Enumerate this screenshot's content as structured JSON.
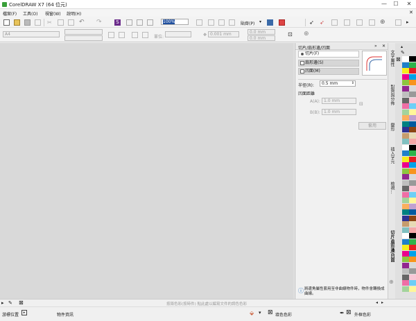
{
  "window": {
    "title": "CorelDRAW X7 (64 位元)",
    "minimize": "—",
    "maximize": "☐",
    "close": "✕"
  },
  "menu": [
    "檔案(F)",
    "工具(O)",
    "視窗(W)",
    "說明(H)"
  ],
  "toolbar": {
    "zoom": "100%",
    "snap_label": "貼齊(P)"
  },
  "propbar": {
    "page_size": "A4",
    "units_label": "單位:",
    "nudge": "0.001 mm",
    "dup_x": "0.0 mm",
    "dup_y": "0.0 mm"
  },
  "docker": {
    "title": "切片/扇形邊/凹面",
    "options": [
      {
        "label": "切片(F)",
        "checked": true
      },
      {
        "label": "扇形邊(S)",
        "checked": false
      },
      {
        "label": "凹面(M)",
        "checked": false
      }
    ],
    "radius_label": "半徑(R):",
    "radius_value": "0.5 mm",
    "group_label": "凹面距離",
    "a_label": "A(A):",
    "a_value": "1.0 mm",
    "b_label": "B(B):",
    "b_value": "1.0 mm",
    "apply": "套用",
    "hint": "將邊角屬性套用至非曲線物件時，物件會轉換成曲線。"
  },
  "tabs": [
    "文字屬性",
    "對齊與分佈",
    "變形",
    "插入字元",
    "檢視...",
    "切片/扇形邊/凹面"
  ],
  "status": {
    "hint_text": "按兩色彩(按時件) 點此處以編寫文件的調色色彩",
    "cursor_label": "游標位置",
    "object_info": "物件資訊",
    "fill_label": "填色色彩",
    "outline_label": "外框色彩"
  },
  "palette_colors": [
    "#ffffff",
    "#000000",
    "#1f7fc9",
    "#2db34a",
    "#f6ec1c",
    "#e51c24",
    "#ec008c",
    "#00a2e9",
    "#8dc63f",
    "#f7941d",
    "#92278f",
    "#d9d9d9",
    "#bfbfbf",
    "#999999",
    "#666666",
    "#f9c7d6",
    "#ef6ea5",
    "#6dcff6",
    "#a3d39c",
    "#fff799",
    "#fbaf5d",
    "#c0a0d0",
    "#008080",
    "#005aa0",
    "#2e3192",
    "#8b4513",
    "#c69c6d",
    "#e8d9b5",
    "#80c0c0",
    "#f4a8a8"
  ]
}
